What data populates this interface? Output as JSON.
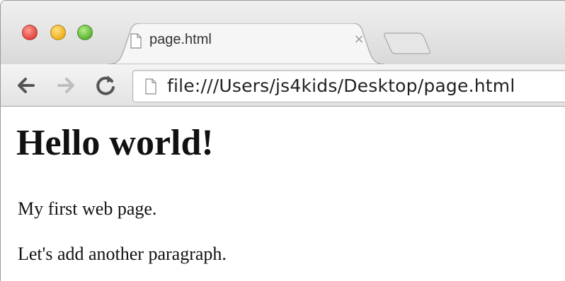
{
  "window": {
    "traffic_lights": [
      "close",
      "minimize",
      "maximize"
    ]
  },
  "tab": {
    "title": "page.html",
    "close_label": "×",
    "icon": "document-icon"
  },
  "toolbar": {
    "back_icon": "arrow-left-icon",
    "forward_icon": "arrow-right-icon",
    "reload_icon": "reload-icon",
    "url": "file:///Users/js4kids/Desktop/page.html"
  },
  "page": {
    "heading": "Hello world!",
    "paragraphs": [
      "My first web page.",
      "Let's add another paragraph."
    ]
  },
  "colors": {
    "close": "#e2463c",
    "minimize": "#ecb120",
    "maximize": "#5cb336"
  }
}
